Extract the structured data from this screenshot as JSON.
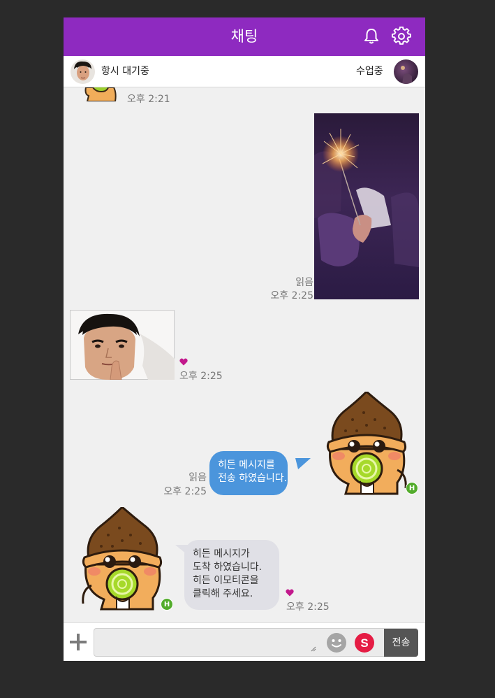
{
  "header": {
    "title": "채팅",
    "icons": [
      "bell-icon",
      "gear-icon"
    ]
  },
  "status": {
    "self_status": "항시 대기중",
    "partner_status": "수업중"
  },
  "messages": {
    "m1": {
      "time": "오후 2:21"
    },
    "m2": {
      "read": "읽음",
      "time": "오후 2:25",
      "image": "sparkler photo"
    },
    "m3": {
      "time": "오후 2:25",
      "image": "man portrait photo"
    },
    "m4": {
      "read": "읽음",
      "time": "오후 2:25",
      "line1": "히든 메시지를",
      "line2": "전송 하였습니다.",
      "badge": "H"
    },
    "m5": {
      "time": "오후 2:25",
      "line1": "히든 메시지가",
      "line2": "도착 하였습니다.",
      "line3": "히든 이모티콘을",
      "line4": "클릭해 주세요.",
      "badge": "H"
    }
  },
  "composer": {
    "send_label": "전송",
    "s_label": "S",
    "icons": [
      "plus-icon",
      "emoji-icon",
      "s-icon"
    ]
  },
  "colors": {
    "header": "#8e2ac0",
    "sent_bubble": "#4b95dc",
    "recv_bubble": "#e0e0e6",
    "badge": "#53ac2c",
    "heart": "#c2188c"
  }
}
